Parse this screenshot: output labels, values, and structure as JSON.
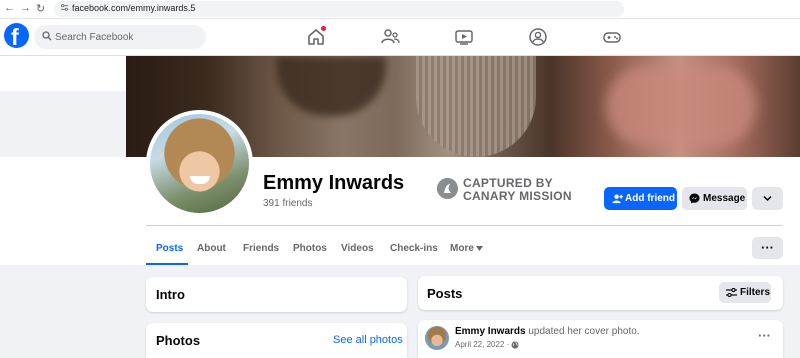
{
  "browser": {
    "url": "facebook.com/emmy.inwards.5"
  },
  "header": {
    "logo_letter": "f",
    "search_placeholder": "Search Facebook",
    "nav_icons": [
      "home-icon",
      "friends-icon",
      "watch-icon",
      "groups-icon",
      "gaming-icon"
    ],
    "accent": "#0866ff"
  },
  "profile": {
    "name": "Emmy Inwards",
    "friends": "391 friends",
    "stamp_line1": "CAPTURED BY",
    "stamp_line2": "CANARY MISSION",
    "add_friend_label": "Add friend",
    "message_label": "Message"
  },
  "tabs": [
    {
      "label": "Posts",
      "active": true
    },
    {
      "label": "About"
    },
    {
      "label": "Friends"
    },
    {
      "label": "Photos"
    },
    {
      "label": "Videos"
    },
    {
      "label": "Check-ins"
    },
    {
      "label": "More"
    }
  ],
  "intro": {
    "title": "Intro"
  },
  "photos": {
    "title": "Photos",
    "see_all": "See all photos"
  },
  "posts": {
    "title": "Posts",
    "filters_label": "Filters",
    "first": {
      "author": "Emmy Inwards",
      "action": "updated her cover photo.",
      "date": "April 22, 2022 ·"
    }
  }
}
